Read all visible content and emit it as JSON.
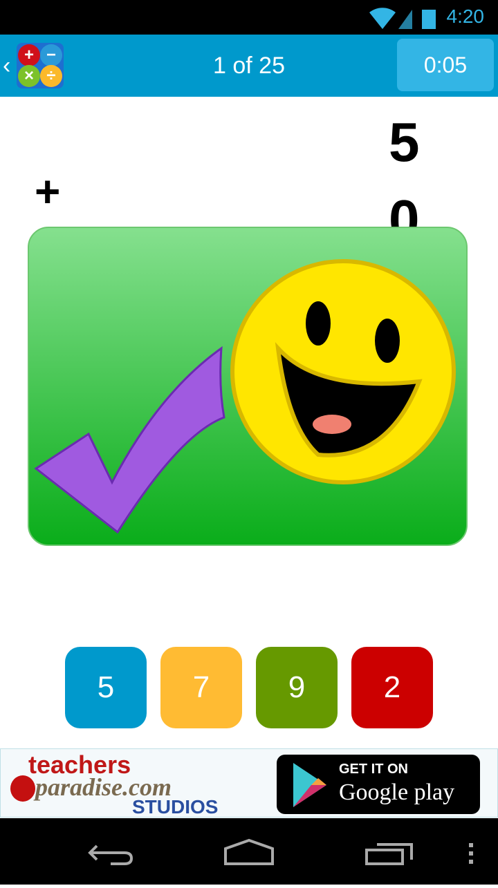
{
  "status_bar": {
    "time": "4:20"
  },
  "app_bar": {
    "progress": "1 of 25",
    "timer": "0:05",
    "logo_symbols": [
      "+",
      "−",
      "×",
      "÷"
    ]
  },
  "problem": {
    "top": "5",
    "operator": "+",
    "bottom": "0"
  },
  "feedback": {
    "result": "correct",
    "icons": [
      "check-icon",
      "smiley-icon"
    ]
  },
  "answers": [
    {
      "label": "5",
      "color": "#0099cc"
    },
    {
      "label": "7",
      "color": "#ffbb33"
    },
    {
      "label": "9",
      "color": "#669900"
    },
    {
      "label": "2",
      "color": "#cc0000"
    }
  ],
  "ad": {
    "brand_line1": "teachers",
    "brand_line2": "paradise.com",
    "brand_line3": "STUDIOS",
    "store_line1": "GET IT ON",
    "store_line2": "Google play"
  }
}
